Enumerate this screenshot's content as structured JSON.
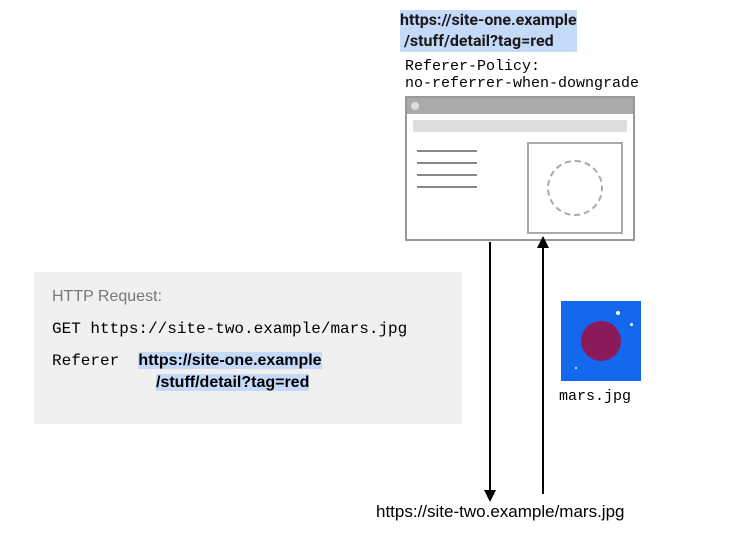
{
  "url_top": {
    "line1": "https://site-one.example",
    "line2": "/stuff/detail?tag=red"
  },
  "policy": {
    "header": "Referer-Policy:",
    "value": "no-referrer-when-downgrade"
  },
  "request": {
    "label": "HTTP Request:",
    "method_line": "GET https://site-two.example/mars.jpg",
    "referer_label": "Referer",
    "referer_line1": "https://site-one.example",
    "referer_line2": "/stuff/detail?tag=red"
  },
  "image": {
    "filename": "mars.jpg"
  },
  "target_url": "https://site-two.example/mars.jpg"
}
